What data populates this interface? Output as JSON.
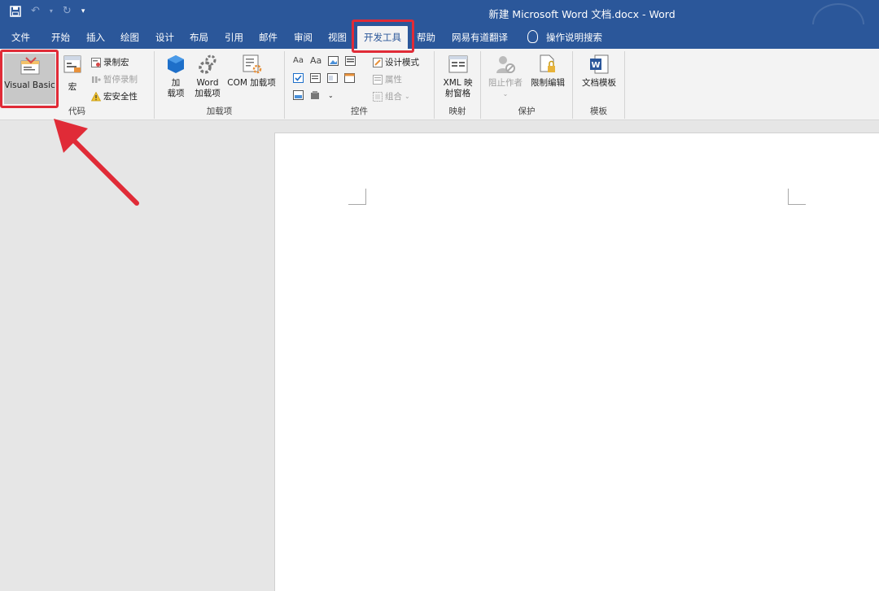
{
  "window": {
    "title": "新建 Microsoft Word 文档.docx  -  Word"
  },
  "qat": {
    "save_icon": "save-icon",
    "undo_icon": "undo-icon",
    "redo_icon": "redo-icon",
    "customize_icon": "customize-qat-icon"
  },
  "tabs": [
    {
      "label": "文件"
    },
    {
      "label": "开始"
    },
    {
      "label": "插入"
    },
    {
      "label": "绘图"
    },
    {
      "label": "设计"
    },
    {
      "label": "布局"
    },
    {
      "label": "引用"
    },
    {
      "label": "邮件"
    },
    {
      "label": "审阅"
    },
    {
      "label": "视图"
    },
    {
      "label": "开发工具",
      "active": true
    },
    {
      "label": "帮助"
    },
    {
      "label": "网易有道翻译"
    },
    {
      "label": "操作说明搜索"
    }
  ],
  "ribbon": {
    "code": {
      "label": "代码",
      "visual_basic": "Visual Basic",
      "macros": "宏",
      "record_macro": "录制宏",
      "pause_recording": "暂停录制",
      "macro_security": "宏安全性"
    },
    "addins": {
      "label": "加载项",
      "addins_line1": "加",
      "addins_line2": "载项",
      "word_addins_line1": "Word",
      "word_addins_line2": "加载项",
      "com_addins": "COM 加载项"
    },
    "controls": {
      "label": "控件",
      "design_mode": "设计模式",
      "properties": "属性",
      "group": "组合"
    },
    "mapping": {
      "label": "映射",
      "xml_line1": "XML 映",
      "xml_line2": "射窗格"
    },
    "protect": {
      "label": "保护",
      "block_authors": "阻止作者",
      "restrict_editing": "限制编辑"
    },
    "templates": {
      "label": "模板",
      "document_template": "文档模板"
    }
  },
  "colors": {
    "accent": "#2b579a",
    "highlight": "#e02b37"
  }
}
